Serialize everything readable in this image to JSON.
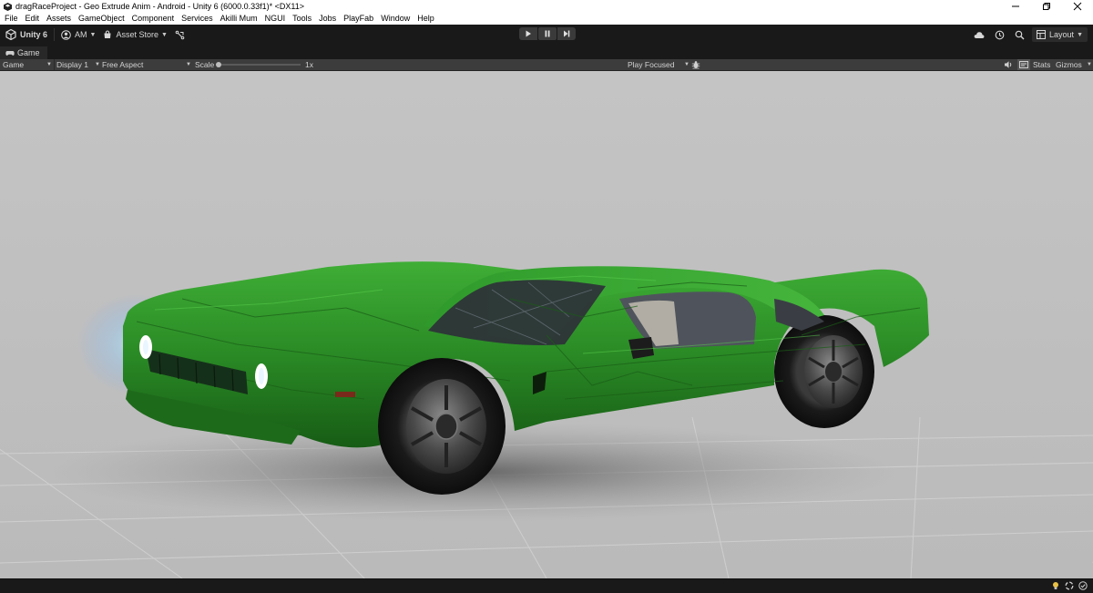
{
  "window": {
    "title": "dragRaceProject - Geo Extrude Anim - Android - Unity 6 (6000.0.33f1)* <DX11>",
    "controls": [
      "minimize-icon",
      "restore-icon",
      "close-icon"
    ]
  },
  "menu": {
    "items": [
      "File",
      "Edit",
      "Assets",
      "GameObject",
      "Component",
      "Services",
      "Akilli Mum",
      "NGUI",
      "Tools",
      "Jobs",
      "PlayFab",
      "Window",
      "Help"
    ]
  },
  "toolbar": {
    "unity_label": "Unity 6",
    "account_label": "AM",
    "asset_store_label": "Asset Store",
    "layout_label": "Layout",
    "icons": {
      "unity": "unity-logo-icon",
      "account": "account-icon",
      "asset_store": "store-icon",
      "version_control": "branch-icon",
      "play": "play-icon",
      "pause": "pause-icon",
      "step": "step-icon",
      "cloud": "cloud-icon",
      "history": "history-icon",
      "search": "search-icon"
    }
  },
  "game_tab": {
    "label": "Game",
    "icon": "gamepad-icon"
  },
  "game_bar": {
    "mode": "Game",
    "display": "Display 1",
    "aspect": "Free Aspect",
    "scale_label": "Scale",
    "scale_value": "1x",
    "scale_fraction": 0,
    "play_mode": "Play Focused",
    "stats_label": "Stats",
    "gizmos_label": "Gizmos",
    "icons": {
      "bug": "bug-icon",
      "audio": "speaker-icon",
      "stats_toggle": "stats-icon"
    }
  },
  "colors": {
    "editor_bg": "#191919",
    "game_bar_bg": "#3c3c3c",
    "car_body": "#2f8f2a",
    "floor": "#c2c2c2"
  }
}
